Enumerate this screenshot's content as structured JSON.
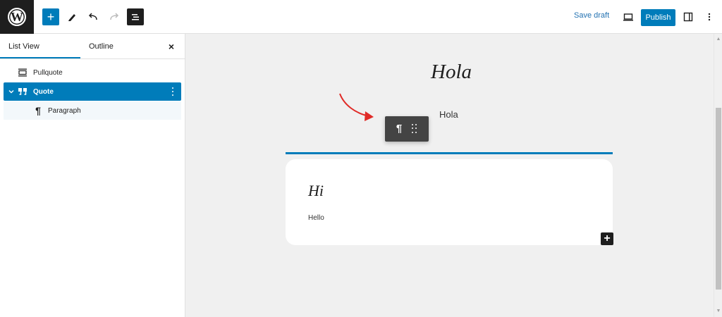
{
  "topbar": {
    "logo_letter": "W",
    "add_symbol": "+",
    "save_draft_label": "Save draft",
    "publish_label": "Publish",
    "accent_color": "#007cba"
  },
  "sidebar": {
    "tabs": [
      {
        "label": "List View"
      },
      {
        "label": "Outline"
      }
    ],
    "close_symbol": "×",
    "items": [
      {
        "label": "Pullquote",
        "icon": "pullquote-icon"
      },
      {
        "label": "Quote",
        "icon": "quote-icon"
      },
      {
        "label": "Paragraph",
        "icon": "paragraph-icon"
      }
    ]
  },
  "canvas": {
    "title": "Hola",
    "paragraph": "Hola",
    "block_toolbar": {
      "paragraph_symbol": "¶"
    },
    "pullquote": {
      "heading": "Hi",
      "text": "Hello"
    },
    "inserter_symbol": "+"
  }
}
